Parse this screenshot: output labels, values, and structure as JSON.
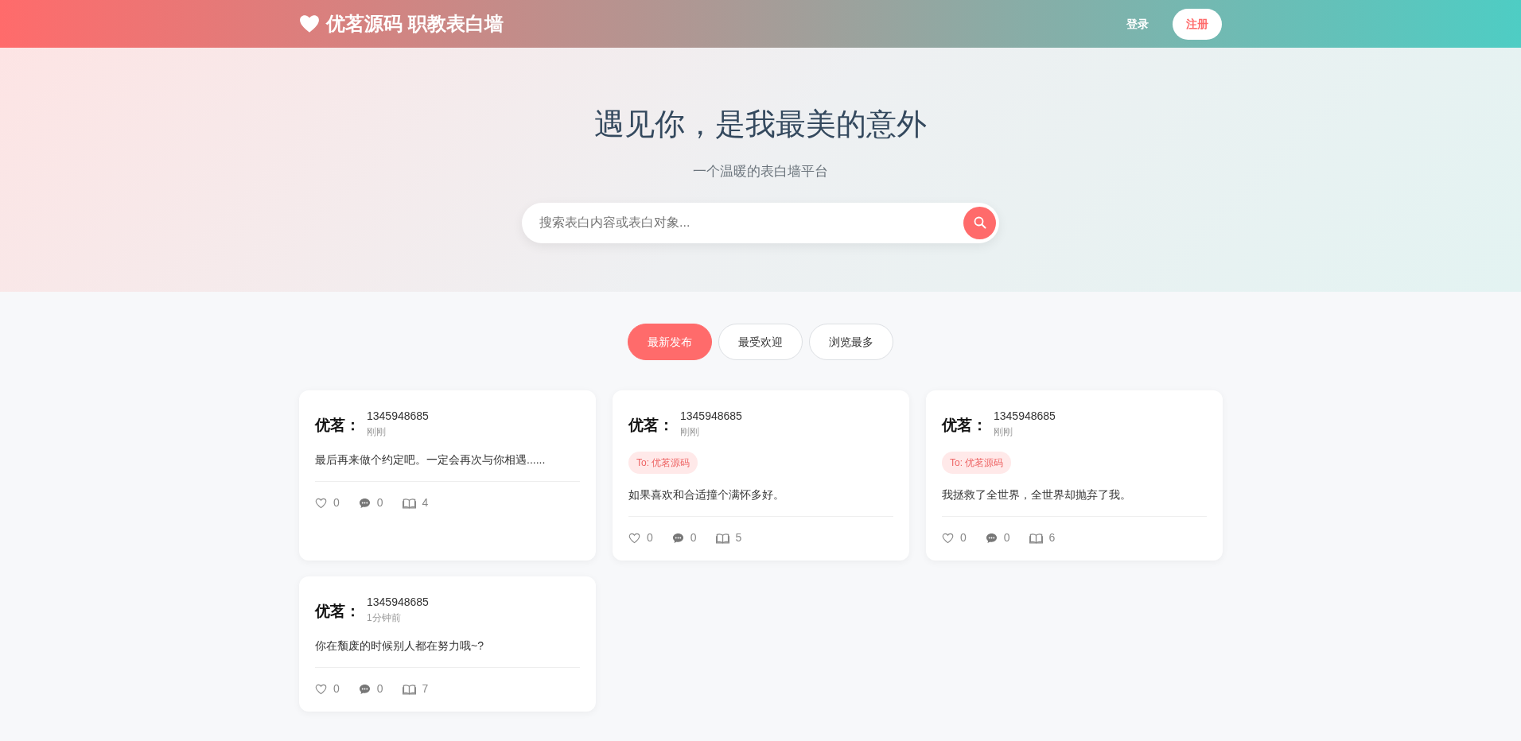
{
  "navbar": {
    "brand": "优茗源码 职教表白墙",
    "links": [
      {
        "label": "登录",
        "kind": "plain"
      },
      {
        "label": "注册",
        "kind": "pill"
      }
    ]
  },
  "hero": {
    "title": "遇见你，是我最美的意外",
    "subtitle": "一个温暖的表白墙平台",
    "search": {
      "placeholder": "搜索表白内容或表白对象..."
    }
  },
  "tabs": [
    {
      "label": "最新发布",
      "selected": true
    },
    {
      "label": "最受欢迎",
      "selected": false
    },
    {
      "label": "浏览最多",
      "selected": false
    }
  ],
  "posts": [
    {
      "nickname": "优茗：",
      "user": "1345948685",
      "time": "刚刚",
      "content": "最后再来做个约定吧。一定会再次与你相遇......",
      "likes": "0",
      "comments": "0",
      "views": "4"
    },
    {
      "nickname": "优茗：",
      "user": "1345948685",
      "time": "刚刚",
      "to": "To: 优茗源码",
      "content": "如果喜欢和合适撞个满怀多好。",
      "likes": "0",
      "comments": "0",
      "views": "5"
    },
    {
      "nickname": "优茗：",
      "user": "1345948685",
      "time": "刚刚",
      "to": "To: 优茗源码",
      "content": "我拯救了全世界，全世界却抛弃了我。",
      "likes": "0",
      "comments": "0",
      "views": "6"
    },
    {
      "nickname": "优茗：",
      "user": "1345948685",
      "time": "1分钟前",
      "content": "你在颓废的时候别人都在努力哦~?",
      "likes": "0",
      "comments": "0",
      "views": "7"
    }
  ]
}
